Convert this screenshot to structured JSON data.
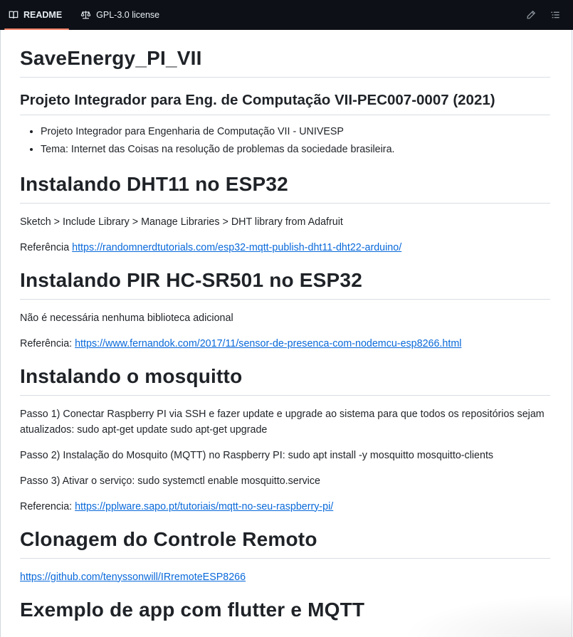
{
  "tabs": [
    {
      "label": "README",
      "icon": "book-icon",
      "active": true
    },
    {
      "label": "GPL-3.0 license",
      "icon": "scale-icon",
      "active": false
    }
  ],
  "actions": {
    "edit_icon": "pencil-icon",
    "outline_icon": "list-icon"
  },
  "readme": {
    "title": "SaveEnergy_PI_VII",
    "subtitle": "Projeto Integrador para Eng. de Computação VII-PEC007-0007 (2021)",
    "intro_items": [
      "Projeto Integrador para Engenharia de Computação VII - UNIVESP",
      "Tema: Internet das Coisas na resolução de problemas da sociedade brasileira."
    ],
    "dht": {
      "heading": "Instalando DHT11 no ESP32",
      "p1": "Sketch > Include Library > Manage Libraries > DHT library from Adafruit",
      "ref_label": "Referência",
      "ref_link": "https://randomnerdtutorials.com/esp32-mqtt-publish-dht11-dht22-arduino/"
    },
    "pir": {
      "heading": "Instalando PIR HC-SR501 no ESP32",
      "p1": "Não é necessária nenhuma biblioteca adicional",
      "ref_label": "Referência:",
      "ref_link": "https://www.fernandok.com/2017/11/sensor-de-presenca-com-nodemcu-esp8266.html"
    },
    "mosquitto": {
      "heading": "Instalando o mosquitto",
      "step1": "Passo 1) Conectar Raspberry PI via SSH e fazer update e upgrade ao sistema para que todos os repositórios sejam atualizados: sudo apt-get update sudo apt-get upgrade",
      "step2": "Passo 2) Instalação do Mosquito (MQTT) no Raspberry PI: sudo apt install -y mosquitto mosquitto-clients",
      "step3": "Passo 3) Ativar o serviço: sudo systemctl enable mosquitto.service",
      "ref_label": "Referencia:",
      "ref_link": "https://pplware.sapo.pt/tutoriais/mqtt-no-seu-raspberry-pi/"
    },
    "clone": {
      "heading": "Clonagem do Controle Remoto",
      "link": "https://github.com/tenyssonwill/IRremoteESP8266"
    },
    "app": {
      "heading": "Exemplo de app com flutter e MQTT"
    }
  },
  "colors": {
    "topbar": "#0d1117",
    "tab_underline": "#f78166",
    "link": "#0969da"
  }
}
